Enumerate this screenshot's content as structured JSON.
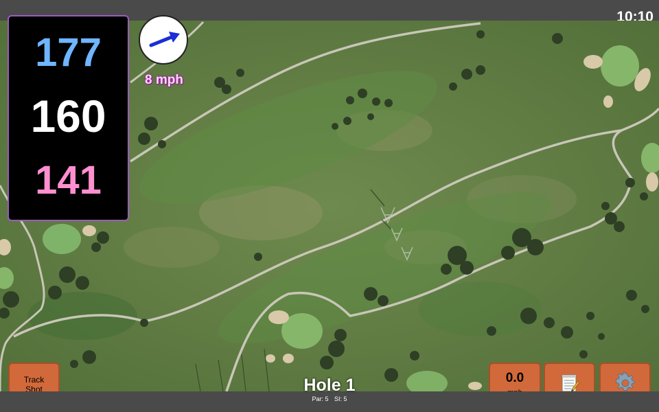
{
  "status": {
    "time": "10:10"
  },
  "distances": {
    "back": "177",
    "middle": "160",
    "front": "141"
  },
  "wind": {
    "speed": "8 mph",
    "direction": "north-east",
    "arrow_color": "#1a2fd6"
  },
  "hole": {
    "title": "Hole 1",
    "par": "Par: 5",
    "si": "SI: 5"
  },
  "buttons": {
    "track_shot_line1": "Track",
    "track_shot_line2": "Shot",
    "speed_value": "0.0",
    "speed_unit": "mph",
    "notes_icon": "notepad-icon",
    "settings_icon": "gear-icon"
  },
  "colors": {
    "accent_button": "#d2693a",
    "panel_border": "#9b5bbd",
    "back_distance": "#6fb5ff",
    "front_distance": "#ff8fcf"
  }
}
